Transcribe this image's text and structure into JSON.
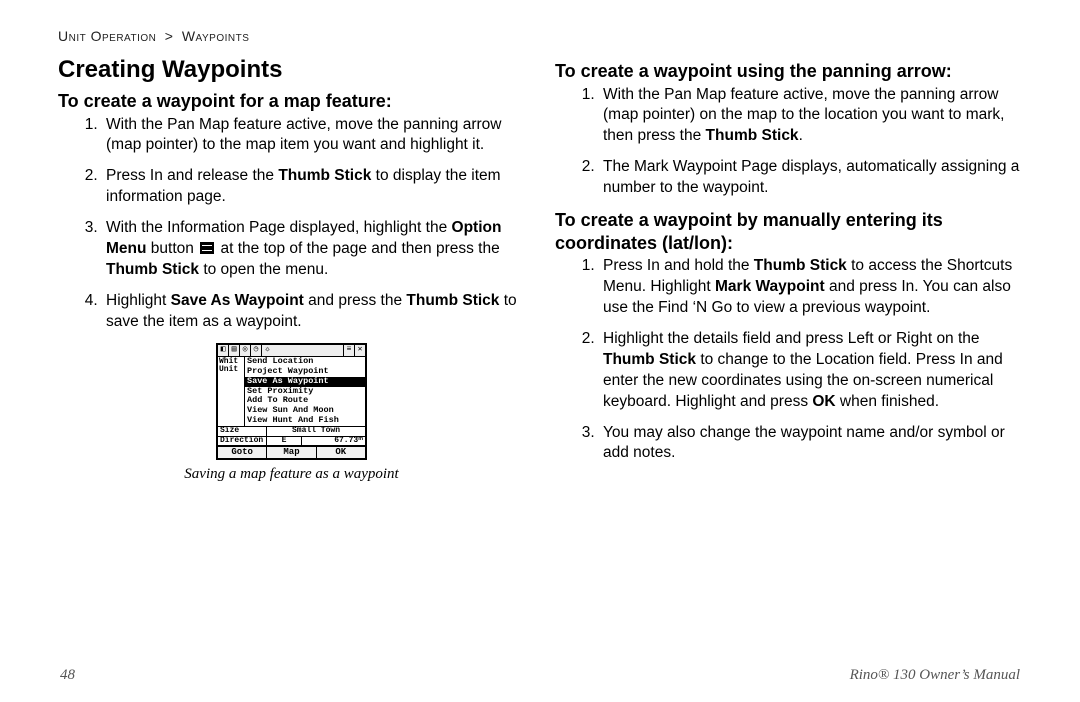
{
  "breadcrumb": {
    "a": "Unit Operation",
    "sep": ">",
    "b": "Waypoints"
  },
  "title": "Creating Waypoints",
  "left": {
    "subhead": "To create a waypoint for a map feature:",
    "items": {
      "i1a": "With the Pan Map feature active, move the panning arrow (map pointer) to the map item you want and highlight it.",
      "i2a": "Press In and release the ",
      "i2b": "Thumb Stick",
      "i2c": " to display the item information page.",
      "i3a": "With the Information Page displayed, highlight the ",
      "i3b": "Option Menu",
      "i3c": " button ",
      "i3d": " at the top of the page and then press the ",
      "i3e": "Thumb Stick",
      "i3f": " to open the menu.",
      "i4a": "Highlight ",
      "i4b": "Save As Waypoint",
      "i4c": " and press the ",
      "i4d": "Thumb Stick",
      "i4e": " to save the item as a waypoint."
    },
    "caption": "Saving a map feature as a waypoint"
  },
  "screen": {
    "labels": {
      "l1": "Whit",
      "l2": "Unit"
    },
    "menu": {
      "m1": "Send Location",
      "m2": "Project Waypoint",
      "m3": "Save As Waypoint",
      "m4": "Set Proximity",
      "m5": "Add To Route",
      "m6": "View Sun And Moon",
      "m7": "View Hunt And Fish"
    },
    "size_label": "Size",
    "size_value": "Small Town",
    "dir_label": "Direction",
    "dir_v1": "E",
    "dir_v2": "67.73ᵐ",
    "btn1": "Goto",
    "btn2": "Map",
    "btn3": "OK"
  },
  "right": {
    "sub1": "To create a waypoint using the panning arrow:",
    "r1": {
      "i1a": "With the Pan Map feature active, move the panning arrow (map pointer) on the map to the location you want to mark, then press the ",
      "i1b": "Thumb Stick",
      "i1c": ".",
      "i2a": "The Mark Waypoint Page displays, automatically assigning a number to the waypoint."
    },
    "sub2": "To create a waypoint by manually entering its coordinates (lat/lon):",
    "r2": {
      "i1a": "Press In and hold the ",
      "i1b": "Thumb Stick",
      "i1c": " to access the Shortcuts Menu. Highlight ",
      "i1d": "Mark Waypoint",
      "i1e": " and press In. You can also use the Find ‘N Go to view a previous waypoint.",
      "i2a": "Highlight the details field and press Left or Right on the ",
      "i2b": "Thumb Stick",
      "i2c": " to change to the Location field. Press In and enter the new coordinates using the on-screen numerical keyboard. Highlight and press ",
      "i2d": "OK",
      "i2e": " when finished.",
      "i3a": "You may also change the waypoint name and/or symbol or add notes."
    }
  },
  "footer": {
    "page": "48",
    "manual": "Rino® 130 Owner’s Manual"
  }
}
